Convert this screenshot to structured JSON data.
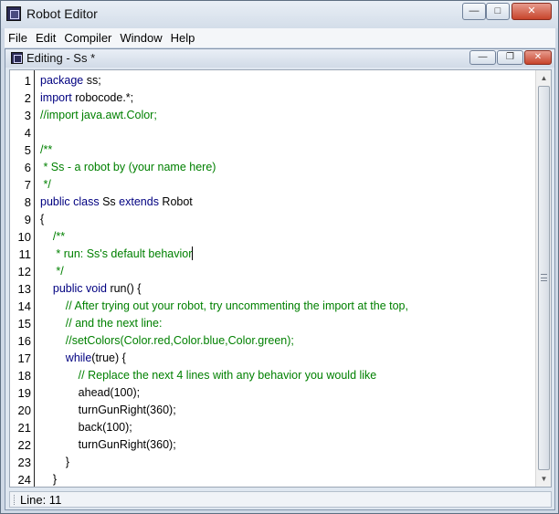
{
  "window": {
    "title": "Robot Editor",
    "controls": {
      "minimize": "—",
      "maximize": "□",
      "close": "✕"
    }
  },
  "menubar": {
    "items": [
      {
        "label": "File"
      },
      {
        "label": "Edit"
      },
      {
        "label": "Compiler"
      },
      {
        "label": "Window"
      },
      {
        "label": "Help"
      }
    ]
  },
  "inner_window": {
    "title": "Editing - Ss *",
    "controls": {
      "minimize": "—",
      "restore": "❐",
      "close": "✕"
    }
  },
  "editor": {
    "line_numbers": [
      "1",
      "2",
      "3",
      "4",
      "5",
      "6",
      "7",
      "8",
      "9",
      "10",
      "11",
      "12",
      "13",
      "14",
      "15",
      "16",
      "17",
      "18",
      "19",
      "20",
      "21",
      "22",
      "23",
      "24"
    ],
    "lines": [
      [
        {
          "t": "package",
          "c": "kw"
        },
        {
          "t": " ss;",
          "c": ""
        }
      ],
      [
        {
          "t": "import",
          "c": "kw"
        },
        {
          "t": " robocode.*;",
          "c": ""
        }
      ],
      [
        {
          "t": "//import java.awt.Color;",
          "c": "cm"
        }
      ],
      [],
      [
        {
          "t": "/**",
          "c": "cm"
        }
      ],
      [
        {
          "t": " * Ss - a robot by (your name here)",
          "c": "cm"
        }
      ],
      [
        {
          "t": " */",
          "c": "cm"
        }
      ],
      [
        {
          "t": "public class",
          "c": "kw"
        },
        {
          "t": " Ss ",
          "c": ""
        },
        {
          "t": "extends",
          "c": "kw"
        },
        {
          "t": " Robot",
          "c": ""
        }
      ],
      [
        {
          "t": "{",
          "c": ""
        }
      ],
      [
        {
          "t": "    /**",
          "c": "cm"
        }
      ],
      [
        {
          "t": "     * run: Ss's default behavior",
          "c": "cm"
        },
        {
          "caret": true
        }
      ],
      [
        {
          "t": "     */",
          "c": "cm"
        }
      ],
      [
        {
          "t": "    public void",
          "c": "kw"
        },
        {
          "t": " run() {",
          "c": ""
        }
      ],
      [
        {
          "t": "        // After trying out your robot, try uncommenting the import at the top,",
          "c": "cm"
        }
      ],
      [
        {
          "t": "        // and the next line:",
          "c": "cm"
        }
      ],
      [
        {
          "t": "        //setColors(Color.red,Color.blue,Color.green);",
          "c": "cm"
        }
      ],
      [
        {
          "t": "        ",
          "c": ""
        },
        {
          "t": "while",
          "c": "kw"
        },
        {
          "t": "(true) {",
          "c": ""
        }
      ],
      [
        {
          "t": "            // Replace the next 4 lines with any behavior you would like",
          "c": "cm"
        }
      ],
      [
        {
          "t": "            ahead(100);",
          "c": ""
        }
      ],
      [
        {
          "t": "            turnGunRight(360);",
          "c": ""
        }
      ],
      [
        {
          "t": "            back(100);",
          "c": ""
        }
      ],
      [
        {
          "t": "            turnGunRight(360);",
          "c": ""
        }
      ],
      [
        {
          "t": "        }",
          "c": ""
        }
      ],
      [
        {
          "t": "    }",
          "c": ""
        }
      ]
    ]
  },
  "scrollbar": {
    "up": "▲",
    "down": "▼"
  },
  "status": {
    "text": "Line: 11"
  }
}
